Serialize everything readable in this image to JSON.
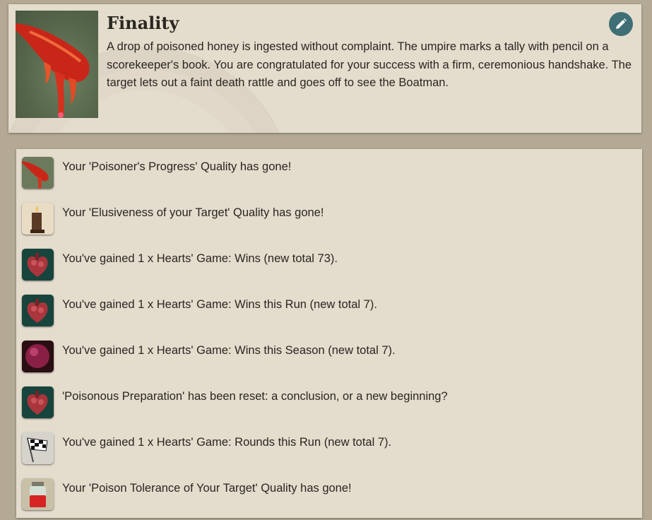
{
  "story": {
    "title": "Finality",
    "description": "A drop of poisoned honey is ingested without complaint. The umpire marks a tally with pencil on a scorekeeper's book. You are congratulated for your success with a firm, ceremonious handshake. The target lets out a faint death rattle and goes off to see the Boatman.",
    "image_icon": "honey-dipper-icon",
    "edit_icon": "pencil-icon"
  },
  "results": [
    {
      "icon": "honey-dipper-icon",
      "text": "Your 'Poisoner's Progress' Quality has gone!"
    },
    {
      "icon": "candle-icon",
      "text": "Your 'Elusiveness of your Target' Quality has gone!"
    },
    {
      "icon": "anatomical-heart-icon",
      "text": "You've gained 1 x Hearts' Game: Wins (new total 73)."
    },
    {
      "icon": "anatomical-heart-icon",
      "text": "You've gained 1 x Hearts' Game: Wins this Run (new total 7)."
    },
    {
      "icon": "crimson-orb-icon",
      "text": "You've gained 1 x Hearts' Game: Wins this Season (new total 7)."
    },
    {
      "icon": "anatomical-heart-icon",
      "text": "'Poisonous Preparation' has been reset: a conclusion, or a new beginning?"
    },
    {
      "icon": "checkered-flag-icon",
      "text": "You've gained 1 x Hearts' Game: Rounds this Run (new total 7)."
    },
    {
      "icon": "poison-jar-icon",
      "text": "Your 'Poison Tolerance of Your Target' Quality has gone!"
    }
  ]
}
